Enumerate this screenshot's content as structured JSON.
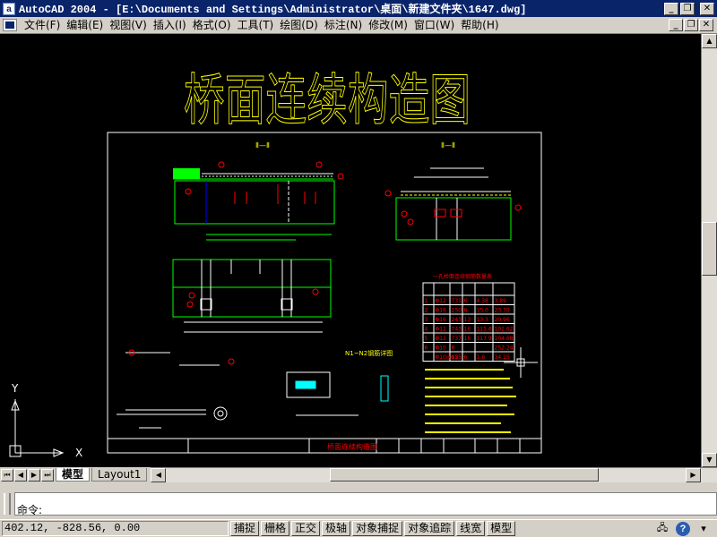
{
  "window": {
    "app_icon": "a",
    "title": "AutoCAD 2004 - [E:\\Documents and Settings\\Administrator\\桌面\\新建文件夹\\1647.dwg]"
  },
  "menu": [
    {
      "label": "文件(F)"
    },
    {
      "label": "编辑(E)"
    },
    {
      "label": "视图(V)"
    },
    {
      "label": "插入(I)"
    },
    {
      "label": "格式(O)"
    },
    {
      "label": "工具(T)"
    },
    {
      "label": "绘图(D)"
    },
    {
      "label": "标注(N)"
    },
    {
      "label": "修改(M)"
    },
    {
      "label": "窗口(W)"
    },
    {
      "label": "帮助(H)"
    }
  ],
  "drawing": {
    "big_title": "桥面连续构造图",
    "section_1": "Ⅱ—Ⅱ",
    "section_2": "Ⅱ—Ⅱ",
    "detail_label": "N1~N2钢筋详图",
    "table_title": "一孔桥面连续钢筋数量表",
    "table_rows": [
      [
        "1",
        "Φ12",
        "731",
        "6",
        "4.38",
        "3.89"
      ],
      [
        "2",
        "Φ16",
        "250",
        "6",
        "15.0",
        "23.70"
      ],
      [
        "3",
        "Φ16",
        "243",
        "13",
        "13.3",
        "20.96"
      ],
      [
        "4",
        "Φ12",
        "743",
        "16",
        "115.6",
        "102.62"
      ],
      [
        "5",
        "Φ12",
        "737",
        "16",
        "117.9",
        "104.68"
      ],
      [
        "6",
        "Φ10",
        "8",
        "",
        "",
        "252.24"
      ],
      [
        "",
        "Φ10@12",
        "855",
        "6",
        "1.6",
        "34.15"
      ]
    ],
    "title_block_label": "桥面连续构造图",
    "ucs_x": "X",
    "ucs_y": "Y"
  },
  "tabs": {
    "model": "模型",
    "layout1": "Layout1"
  },
  "command": {
    "prompt": "命令:"
  },
  "status": {
    "coords": "402.12, -828.56, 0.00",
    "toggles": [
      {
        "label": "捕捉",
        "on": false
      },
      {
        "label": "栅格",
        "on": false
      },
      {
        "label": "正交",
        "on": false
      },
      {
        "label": "极轴",
        "on": false
      },
      {
        "label": "对象捕捉",
        "on": false
      },
      {
        "label": "对象追踪",
        "on": false
      },
      {
        "label": "线宽",
        "on": false
      },
      {
        "label": "模型",
        "on": false
      }
    ]
  },
  "colors": {
    "title_blue": "#0a246a",
    "canvas": "#000000",
    "yellow": "#ffff00",
    "green": "#00ff00",
    "red": "#ff0000",
    "cyan": "#00ffff",
    "white": "#ffffff"
  }
}
